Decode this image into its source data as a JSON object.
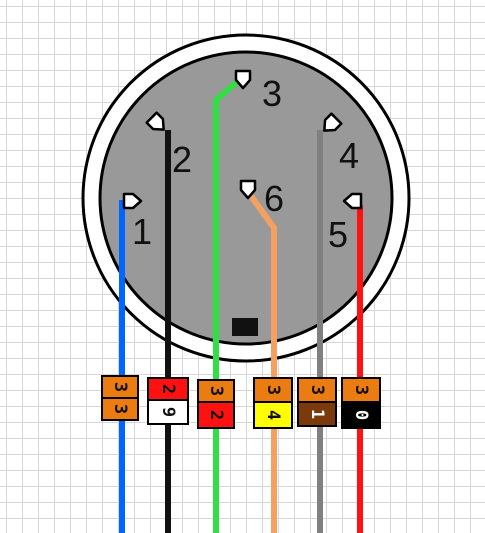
{
  "connector": {
    "type": "6-pin circular connector",
    "outer_ring_color": "#ffffff",
    "face_color": "#999999",
    "key_color": "#111111"
  },
  "pins": [
    {
      "number": "1",
      "wire_color": "#0066ff"
    },
    {
      "number": "2",
      "wire_color": "#111111"
    },
    {
      "number": "3",
      "wire_color": "#33dd44"
    },
    {
      "number": "4",
      "wire_color": "#808080"
    },
    {
      "number": "5",
      "wire_color": "#ff1111"
    },
    {
      "number": "6",
      "wire_color": "#f4a060"
    }
  ],
  "wire_labels": [
    {
      "pin": "1",
      "top": {
        "text": "3",
        "bg": "#ea7c12",
        "fg": "#111111"
      },
      "bottom": {
        "text": "3",
        "bg": "#ea7c12",
        "fg": "#111111"
      }
    },
    {
      "pin": "2",
      "top": {
        "text": "2",
        "bg": "#ff1111",
        "fg": "#111111"
      },
      "bottom": {
        "text": "9",
        "bg": "#ffffff",
        "fg": "#111111"
      }
    },
    {
      "pin": "3",
      "top": {
        "text": "3",
        "bg": "#ea7c12",
        "fg": "#111111"
      },
      "bottom": {
        "text": "2",
        "bg": "#ff1111",
        "fg": "#111111"
      }
    },
    {
      "pin": "6",
      "top": {
        "text": "3",
        "bg": "#ea7c12",
        "fg": "#111111"
      },
      "bottom": {
        "text": "4",
        "bg": "#ffff00",
        "fg": "#111111"
      }
    },
    {
      "pin": "4",
      "top": {
        "text": "3",
        "bg": "#ea7c12",
        "fg": "#111111"
      },
      "bottom": {
        "text": "1",
        "bg": "#7a3a0c",
        "fg": "#ffffff"
      }
    },
    {
      "pin": "5",
      "top": {
        "text": "3",
        "bg": "#ea7c12",
        "fg": "#111111"
      },
      "bottom": {
        "text": "0",
        "bg": "#000000",
        "fg": "#ffffff"
      }
    }
  ]
}
